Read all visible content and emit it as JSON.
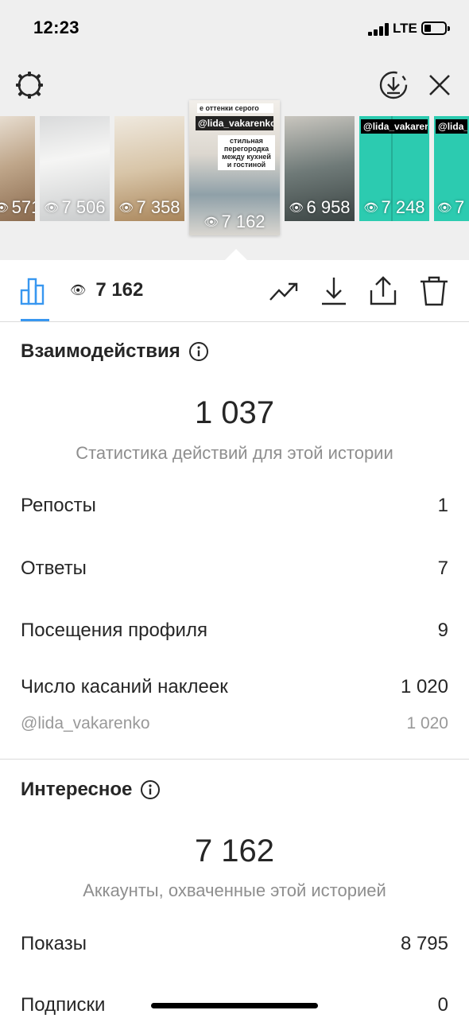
{
  "status_bar": {
    "time": "12:23",
    "network": "LTE"
  },
  "top_bar": {
    "left_icon": "gear-icon",
    "right_icons": [
      "download-circle-icon",
      "close-icon"
    ]
  },
  "stories": [
    {
      "views": "571",
      "handle": ""
    },
    {
      "views": "7 506",
      "handle": ""
    },
    {
      "views": "7 358",
      "handle": ""
    },
    {
      "views": "7 162",
      "handle": "@lida_vakarenko",
      "caption": "е оттенки серого",
      "caption2": "стильная перегородка между кухней и гостиной",
      "selected": true
    },
    {
      "views": "6 958",
      "handle": ""
    },
    {
      "views": "7 248",
      "handle": "@lida_vakarenko"
    },
    {
      "views": "7",
      "handle": "@lida_vakarenko"
    }
  ],
  "toolbar": {
    "views": "7 162",
    "icons": [
      "bar-chart-icon",
      "trend-icon",
      "download-icon",
      "share-icon",
      "trash-icon"
    ],
    "accent_color": "#3897f0"
  },
  "interactions": {
    "title": "Взаимодействия",
    "total": "1 037",
    "caption": "Статистика действий для этой истории",
    "rows": [
      {
        "label": "Репосты",
        "value": "1"
      },
      {
        "label": "Ответы",
        "value": "7"
      },
      {
        "label": "Посещения профиля",
        "value": "9"
      },
      {
        "label": "Число касаний наклеек",
        "value": "1 020"
      }
    ],
    "sub_row": {
      "label": "@lida_vakarenko",
      "value": "1 020"
    }
  },
  "discovery": {
    "title": "Интересное",
    "total": "7 162",
    "caption": "Аккаунты, охваченные этой историей",
    "rows": [
      {
        "label": "Показы",
        "value": "8 795"
      },
      {
        "label": "Подписки",
        "value": "0"
      }
    ]
  }
}
